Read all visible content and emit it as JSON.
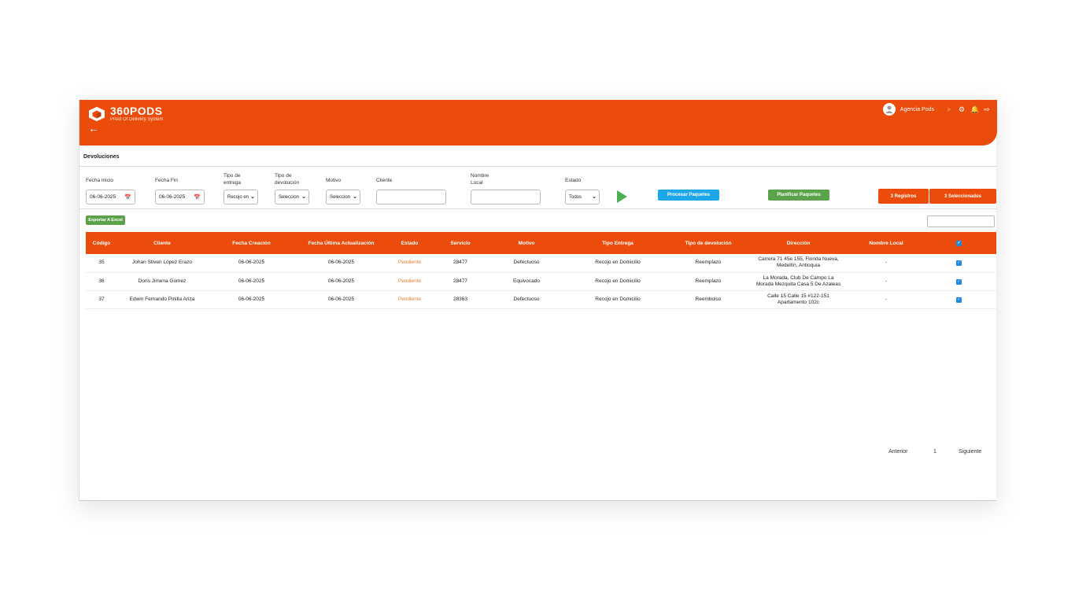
{
  "brand": {
    "title": "360PODS",
    "subtitle": "Proof Of Delivery System"
  },
  "user": {
    "name": "Agencia Pods"
  },
  "page_title": "Devoluciones",
  "filters": {
    "fecha_inicio_label": "Fecha Inicio",
    "fecha_inicio_value": "06-06-2025",
    "fecha_fin_label": "Fecha Fin",
    "fecha_fin_value": "06-06-2025",
    "tipo_entrega_label_1": "Tipo de",
    "tipo_entrega_label_2": "entrega",
    "tipo_entrega_value": "Recojo en",
    "tipo_devolucion_label_1": "Tipo de",
    "tipo_devolucion_label_2": "devolución",
    "tipo_devolucion_value": "Seleccion",
    "motivo_label": "Motivo",
    "motivo_value": "Seleccion",
    "cliente_label": "Cliente",
    "cliente_value": "",
    "nombre_local_label_1": "Nombre",
    "nombre_local_label_2": "Local",
    "nombre_local_value": "",
    "estado_label": "Estado",
    "estado_value": "Todos"
  },
  "buttons": {
    "procesar": "Procesar Paquetes",
    "planificar": "Planificar Paquetes",
    "registros": "3 Registros",
    "seleccionados": "3 Seleccionados",
    "exportar": "Exportar A Excel"
  },
  "colors": {
    "brand": "#eb4c0b",
    "blue": "#1ea7e8",
    "green": "#5aa34a",
    "estado": "#eb7a2b"
  },
  "table": {
    "headers": [
      "Código",
      "Cliente",
      "Fecha Creación",
      "Fecha Última Actualización",
      "Estado",
      "Servicio",
      "Motivo",
      "Tipo Entrega",
      "Tipo de devolución",
      "Dirección",
      "Nombre Local"
    ],
    "rows": [
      {
        "codigo": "35",
        "cliente": "Johan Stiven López Erazo",
        "fecha_creacion": "06-06-2025",
        "fecha_actualizacion": "06-06-2025",
        "estado": "Pendiente",
        "servicio": "28477",
        "motivo": "Defectuoso",
        "tipo_entrega": "Recojo en Domicilio",
        "tipo_devolucion": "Reemplazo",
        "direccion_1": "Carrera 71 45e 155, Florida Nueva,",
        "direccion_2": "Medellín, Antioquia",
        "nombre_local": "-"
      },
      {
        "codigo": "36",
        "cliente": "Doris Jimena Gomez",
        "fecha_creacion": "06-06-2025",
        "fecha_actualizacion": "06-06-2025",
        "estado": "Pendiente",
        "servicio": "28477",
        "motivo": "Equivocado",
        "tipo_entrega": "Recojo en Domicilio",
        "tipo_devolucion": "Reemplazo",
        "direccion_1": "La Morada, Club De Campo La",
        "direccion_2": "Morada Mezquita Casa 5 De Azaleas",
        "nombre_local": "-"
      },
      {
        "codigo": "37",
        "cliente": "Edwin Fernando Pinilla Ariza",
        "fecha_creacion": "06-06-2025",
        "fecha_actualizacion": "06-06-2025",
        "estado": "Pendiente",
        "servicio": "28363",
        "motivo": "Defectuoso",
        "tipo_entrega": "Recojo en Domicilio",
        "tipo_devolucion": "Reembolso",
        "direccion_1": "Calle 15 Calle 15 #122-151",
        "direccion_2": "Apartamento 102c",
        "nombre_local": "-"
      }
    ]
  },
  "pagination": {
    "prev": "Anterior",
    "page": "1",
    "next": "Siguiente"
  }
}
